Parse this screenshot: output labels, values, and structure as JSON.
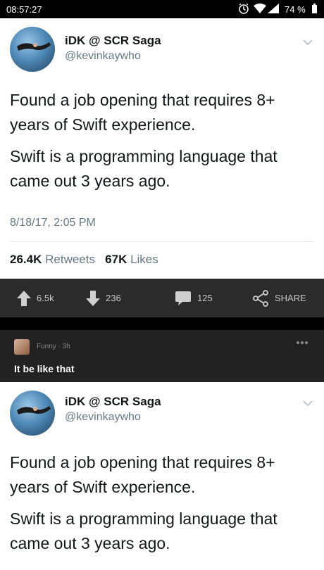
{
  "status_bar": {
    "time": "08:57:27",
    "battery_percent": "74 %"
  },
  "tweets": [
    {
      "name": "iDK @ SCR Saga",
      "handle": "@kevinkaywho",
      "paragraphs": [
        "Found a job opening that requires 8+ years of Swift experience.",
        "Swift is a programming language that came out 3 years ago."
      ],
      "timestamp": "8/18/17, 2:05 PM",
      "retweets_count": "26.4K",
      "retweets_label": "Retweets",
      "likes_count": "67K",
      "likes_label": "Likes"
    },
    {
      "name": "iDK @ SCR Saga",
      "handle": "@kevinkaywho",
      "paragraphs": [
        "Found a job opening that requires 8+ years of Swift experience.",
        "Swift is a programming language that came out 3 years ago."
      ]
    }
  ],
  "action_bar": {
    "upvotes": "6.5k",
    "downvotes": "236",
    "comments": "125",
    "share_label": "SHARE"
  },
  "comment": {
    "meta": "Funny · 3h",
    "text": "It be like that"
  },
  "colors": {
    "action_bar_bg": "#2b2b2b",
    "comment_bg": "#222222",
    "muted_text": "#657786"
  }
}
